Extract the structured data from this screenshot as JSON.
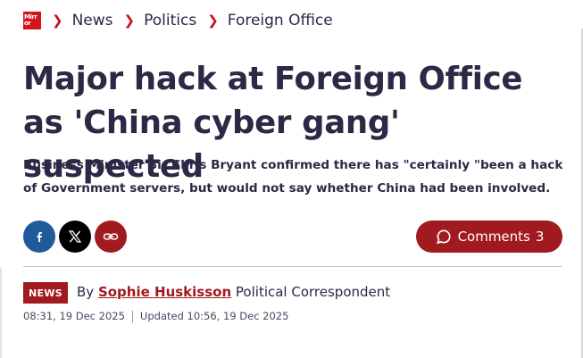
{
  "breadcrumb": {
    "logo_text": "Mirror",
    "items": [
      "News",
      "Politics",
      "Foreign Office"
    ]
  },
  "article": {
    "headline": "Major hack at Foreign Office as 'China cyber gang' suspected",
    "standfirst": "Business Minister Sir Chris Bryant confirmed there has \"certainly \"been a hack of Government servers, but would not say whether China had been involved."
  },
  "share": {
    "facebook_icon": "facebook-icon",
    "x_icon": "x-icon",
    "link_icon": "link-icon"
  },
  "comments": {
    "label": "Comments",
    "count": "3"
  },
  "byline": {
    "tag": "NEWS",
    "by": "By",
    "author": "Sophie Huskisson",
    "role": "Political Correspondent",
    "published": "08:31, 19 Dec 2025",
    "updated": "Updated 10:56, 19 Dec 2025"
  },
  "colors": {
    "accent": "#a01a1f",
    "brand_red": "#d6131a",
    "text": "#2b2945",
    "facebook": "#1f5b9b"
  }
}
